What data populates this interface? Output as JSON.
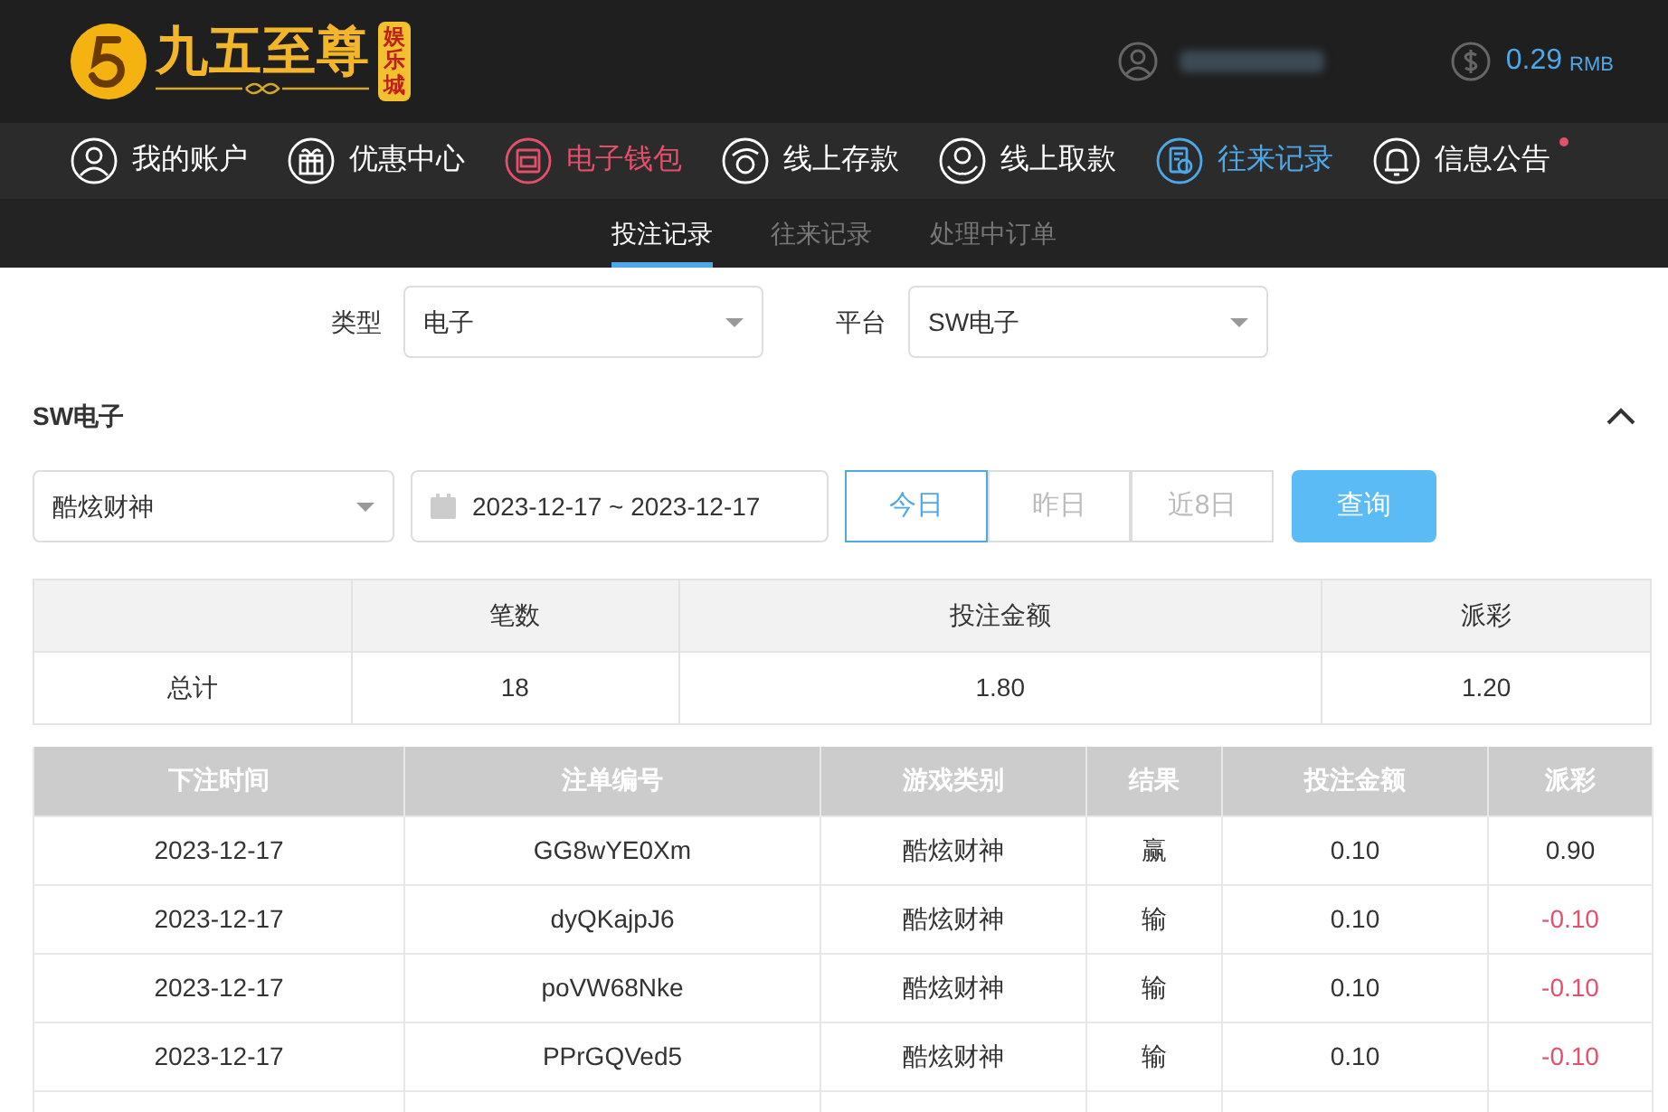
{
  "header": {
    "logo_text": "九五至尊",
    "logo_badge": "娱乐城",
    "balance": "0.29",
    "currency": "RMB"
  },
  "nav": [
    {
      "label": "我的账户",
      "kind": "user",
      "selected": false,
      "highlighted": false,
      "badge": false
    },
    {
      "label": "优惠中心",
      "kind": "gift",
      "selected": false,
      "highlighted": false,
      "badge": false
    },
    {
      "label": "电子钱包",
      "kind": "wallet",
      "selected": false,
      "highlighted": true,
      "badge": false
    },
    {
      "label": "线上存款",
      "kind": "deposit",
      "selected": false,
      "highlighted": false,
      "badge": false
    },
    {
      "label": "线上取款",
      "kind": "withdraw",
      "selected": false,
      "highlighted": false,
      "badge": false
    },
    {
      "label": "往来记录",
      "kind": "record",
      "selected": true,
      "highlighted": false,
      "badge": false
    },
    {
      "label": "信息公告",
      "kind": "bell",
      "selected": false,
      "highlighted": false,
      "badge": true
    }
  ],
  "sub_tabs": [
    {
      "label": "投注记录",
      "selected": true
    },
    {
      "label": "往来记录",
      "selected": false
    },
    {
      "label": "处理中订单",
      "selected": false
    }
  ],
  "filters": [
    {
      "label": "类型",
      "value": "电子"
    },
    {
      "label": "平台",
      "value": "SW电子"
    }
  ],
  "section": {
    "title": "SW电子",
    "expanded": true,
    "game": "酷炫财神",
    "date_range": "2023-12-17 ~ 2023-12-17",
    "quick_dates": [
      {
        "label": "今日",
        "selected": true
      },
      {
        "label": "昨日",
        "selected": false
      },
      {
        "label": "近8日",
        "selected": false
      }
    ],
    "query_button": "查询"
  },
  "summary": {
    "columns": [
      "",
      "笔数",
      "投注金额",
      "派彩"
    ],
    "rows": [
      [
        "总计",
        "18",
        "1.80",
        "1.20"
      ]
    ]
  },
  "records": {
    "columns": [
      "下注时间",
      "注单编号",
      "游戏类别",
      "结果",
      "投注金额",
      "派彩"
    ],
    "rows": [
      {
        "cells": [
          "2023-12-17",
          "GG8wYE0Xm",
          "酷炫财神",
          "赢",
          "0.10",
          "0.90"
        ],
        "payout_negative": false
      },
      {
        "cells": [
          "2023-12-17",
          "dyQKajpJ6",
          "酷炫财神",
          "输",
          "0.10",
          "-0.10"
        ],
        "payout_negative": true
      },
      {
        "cells": [
          "2023-12-17",
          "poVW68Nke",
          "酷炫财神",
          "输",
          "0.10",
          "-0.10"
        ],
        "payout_negative": true
      },
      {
        "cells": [
          "2023-12-17",
          "PPrGQVed5",
          "酷炫财神",
          "输",
          "0.10",
          "-0.10"
        ],
        "payout_negative": true
      }
    ]
  }
}
